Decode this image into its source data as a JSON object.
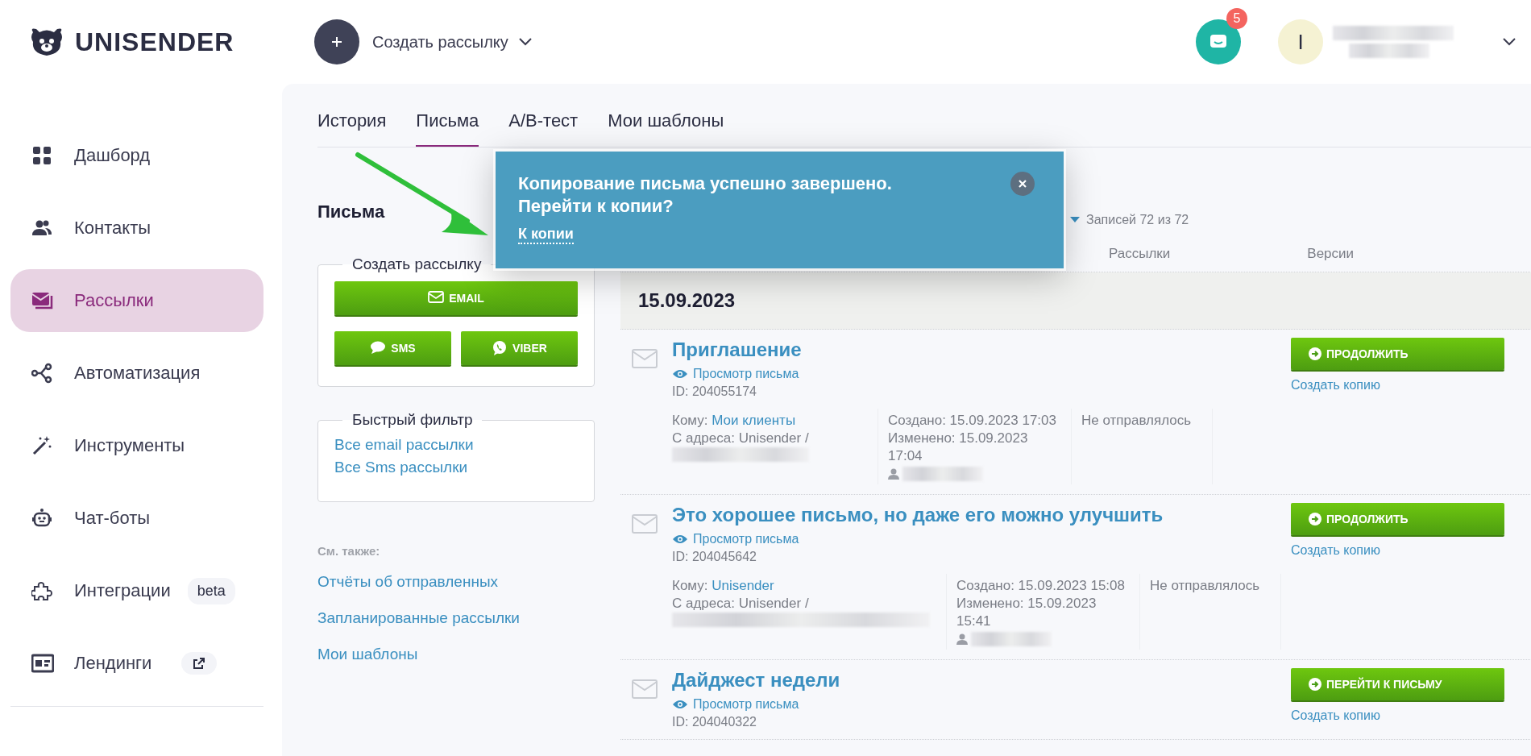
{
  "header": {
    "logo": "UNISENDER",
    "create_label": "Создать рассылку",
    "notifications": "5",
    "avatar_initial": "I"
  },
  "sidebar": {
    "items": [
      {
        "label": "Дашборд",
        "kind": "grid",
        "selected": false
      },
      {
        "label": "Контакты",
        "kind": "people",
        "selected": false
      },
      {
        "label": "Рассылки",
        "kind": "mail",
        "selected": true
      },
      {
        "label": "Автоматизация",
        "kind": "flow",
        "selected": false
      },
      {
        "label": "Инструменты",
        "kind": "wand",
        "selected": false
      },
      {
        "label": "Чат-боты",
        "kind": "bot",
        "selected": false
      },
      {
        "label": "Интеграции",
        "kind": "puzzle",
        "selected": false,
        "badge": "beta"
      },
      {
        "label": "Лендинги",
        "kind": "page",
        "selected": false,
        "external": true
      }
    ]
  },
  "tabs": [
    {
      "label": "История",
      "selected": false
    },
    {
      "label": "Письма",
      "selected": true
    },
    {
      "label": "A/B-тест",
      "selected": false
    },
    {
      "label": "Мои шаблоны",
      "selected": false
    }
  ],
  "left": {
    "title": "Письма",
    "create_group": {
      "legend": "Создать рассылку",
      "buttons": [
        {
          "label": "EMAIL",
          "kind": "email"
        },
        {
          "label": "SMS",
          "kind": "sms"
        },
        {
          "label": "VIBER",
          "kind": "viber"
        }
      ]
    },
    "quick_filter": {
      "legend": "Быстрый фильтр",
      "links": [
        "Все email рассылки",
        "Все Sms рассылки"
      ]
    },
    "see_also": {
      "title": "См. также:",
      "links": [
        "Отчёты об отправленных",
        "Запланированные рассылки",
        "Мои шаблоны"
      ]
    }
  },
  "list": {
    "records": "Записей 72 из 72",
    "columns": [
      "Рассылки",
      "Версии"
    ],
    "date_group": "15.09.2023",
    "letters": [
      {
        "title": "Приглашение",
        "view_link": "Просмотр письма",
        "id": "ID: 204055174",
        "to_label": "Кому:",
        "to_value": "Мои клиенты",
        "from": "С адреса: Unisender /",
        "created": "Создано: 15.09.2023 17:03",
        "modified": "Изменено: 15.09.2023 17:04",
        "status": "Не отправлялось",
        "action": "ПРОДОЛЖИТЬ",
        "copy_link": "Создать копию"
      },
      {
        "title": "Это хорошее письмо, но даже его можно улучшить",
        "view_link": "Просмотр письма",
        "id": "ID: 204045642",
        "to_label": "Кому:",
        "to_value": "Unisender",
        "from": "С адреса: Unisender /",
        "created": "Создано: 15.09.2023 15:08",
        "modified": "Изменено: 15.09.2023 15:41",
        "status": "Не отправлялось",
        "action": "ПРОДОЛЖИТЬ",
        "copy_link": "Создать копию"
      },
      {
        "title": "Дайджест недели",
        "view_link": "Просмотр письма",
        "id": "ID: 204040322",
        "action": "ПЕРЕЙТИ К ПИСЬМУ",
        "copy_link": "Создать копию"
      }
    ]
  },
  "popup": {
    "message": "Копирование письма успешно завершено. Перейти к копии?",
    "link": "К копии"
  }
}
